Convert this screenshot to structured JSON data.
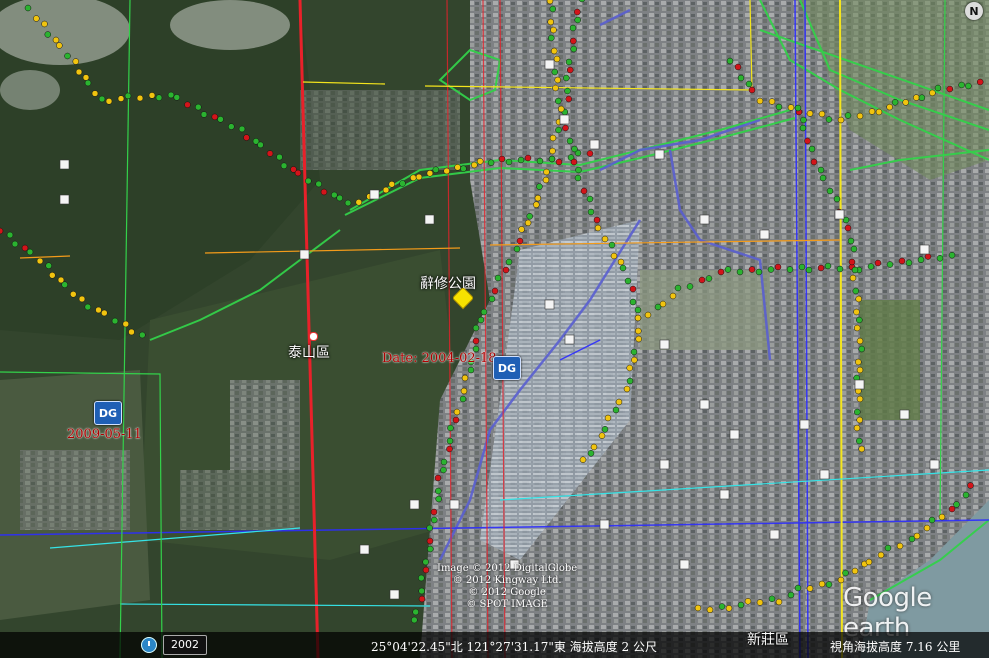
{
  "map": {
    "compass_label": "N",
    "place_labels": {
      "taishan": "泰山區",
      "park": "辭修公園",
      "xinzhuang": "新莊區"
    },
    "imagery_dates": [
      "2004-02-18",
      "2009-05-11"
    ],
    "date_prefix": "Date: ",
    "dg_badge_text": "DG",
    "credits": [
      "Image © 2012 DigitalGlobe",
      "© 2012 Kingway Ltd.",
      "© 2012 Google",
      "© SPOT IMAGE"
    ],
    "logo": "Google earth",
    "colors": {
      "boundary_red": "#e8212a",
      "road_green": "#33d14a",
      "river_blue": "#5a5fd0",
      "marker_green": "#2bb330",
      "marker_yellow": "#f1c40f",
      "marker_red": "#d3141a"
    }
  },
  "status": {
    "timeline_year": "2002",
    "coordinates": "25°04'22.45\"北  121°27'31.17\"東 海拔高度  2 公尺",
    "view_altitude": "視角海拔高度     7.16 公里"
  }
}
